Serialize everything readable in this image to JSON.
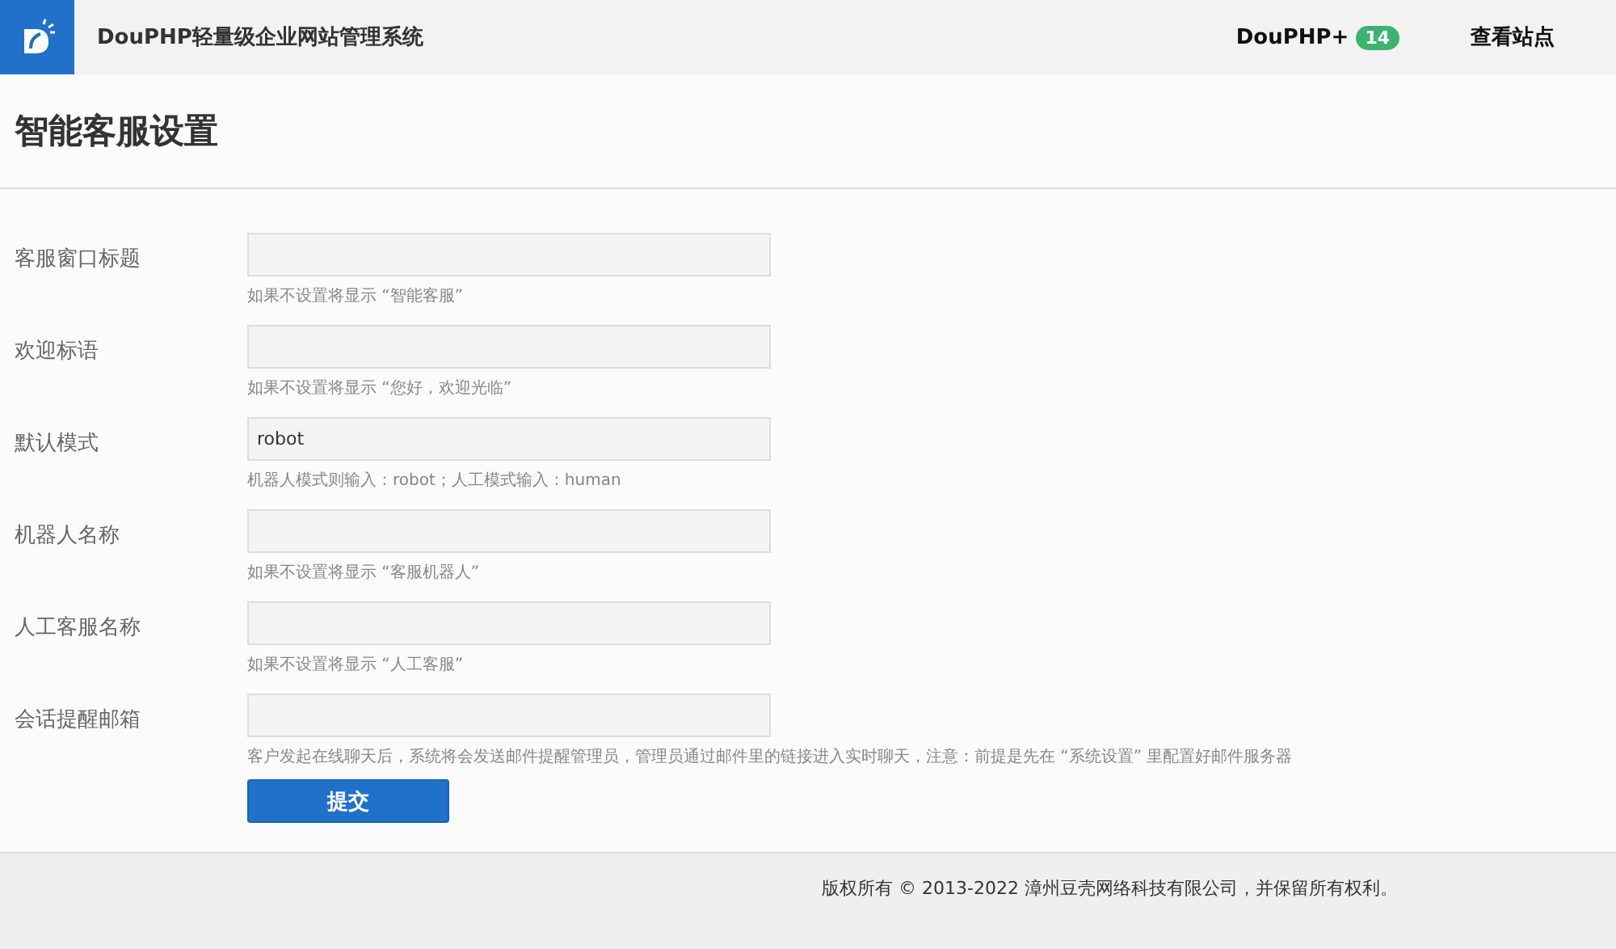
{
  "header": {
    "title": "DouPHP轻量级企业网站管理系统",
    "plus_label": "DouPHP+",
    "plus_count": "14",
    "view_site": "查看站点"
  },
  "page_title": "智能客服设置",
  "fields": [
    {
      "label": "客服窗口标题",
      "note": "如果不设置将显示 “智能客服”"
    },
    {
      "label": "欢迎标语",
      "note": "如果不设置将显示 “您好，欢迎光临”"
    },
    {
      "label": "默认模式",
      "value": "robot",
      "note": "机器人模式则输入：robot；人工模式输入：human"
    },
    {
      "label": "机器人名称",
      "note": "如果不设置将显示 “客服机器人”"
    },
    {
      "label": "人工客服名称",
      "note": "如果不设置将显示 “人工客服”"
    },
    {
      "label": "会话提醒邮箱",
      "note": "客户发起在线聊天后，系统将会发送邮件提醒管理员，管理员通过邮件里的链接进入实时聊天，注意：前提是先在 “系统设置” 里配置好邮件服务器"
    }
  ],
  "submit": "提交",
  "footer": "版权所有 © 2013-2022 漳州豆壳网络科技有限公司，并保留所有权利。"
}
